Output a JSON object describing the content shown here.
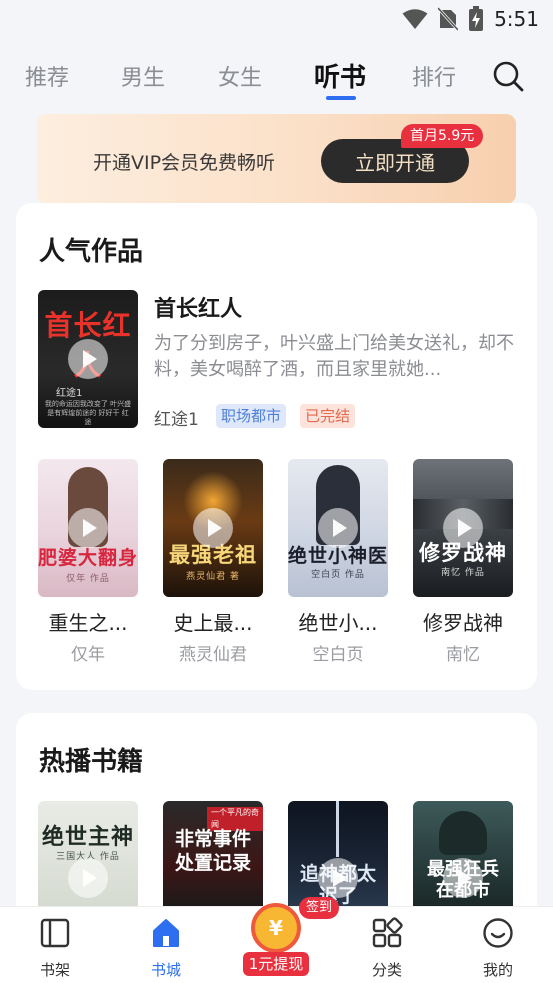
{
  "status_bar": {
    "time": "5:51",
    "icons": [
      "wifi-icon",
      "no-sim-icon",
      "battery-charging-icon"
    ]
  },
  "tabs": [
    {
      "label": "推荐",
      "active": false
    },
    {
      "label": "男生",
      "active": false
    },
    {
      "label": "女生",
      "active": false
    },
    {
      "label": "听书",
      "active": true
    },
    {
      "label": "排行",
      "active": false
    }
  ],
  "vip_banner": {
    "text": "开通VIP会员免费畅听",
    "button": "立即开通",
    "badge": "首月5.9元"
  },
  "popular": {
    "title": "人气作品",
    "featured": {
      "title": "首长红人",
      "description": "为了分到房子，叶兴盛上门给美女送礼，却不料，美女喝醉了酒，而且家里就她...",
      "author": "红途1",
      "tags": [
        "职场都市",
        "已完结"
      ],
      "cover": {
        "title": "首长红人",
        "author_line": "红途1",
        "blurb": "我的命运因我改变了 叶兴盛是有辉煌前途的 好好干 红途"
      }
    },
    "books": [
      {
        "name": "重生之...",
        "author": "仅年",
        "cover_title": "肥婆大翻身",
        "cover_sub": "仅年 作品"
      },
      {
        "name": "史上最...",
        "author": "燕灵仙君",
        "cover_title": "最强老祖",
        "cover_sub": "燕灵仙君 著"
      },
      {
        "name": "绝世小...",
        "author": "空白页",
        "cover_title": "绝世小神医",
        "cover_sub": "空白页 作品"
      },
      {
        "name": "修罗战神",
        "author": "南忆",
        "cover_title": "修罗战神",
        "cover_sub": "南忆 作品"
      }
    ]
  },
  "hot": {
    "title": "热播书籍",
    "books": [
      {
        "cover_title": "绝世主神",
        "cover_sub": "三国大人 作品"
      },
      {
        "cover_title": "非常事件处置记录",
        "cover_sub": "一个平凡的奇闻"
      },
      {
        "cover_title": "追神都太迟了"
      },
      {
        "cover_title": "最强狂兵在都市"
      }
    ]
  },
  "bottom_nav": {
    "items": [
      {
        "label": "书架",
        "active": false
      },
      {
        "label": "书城",
        "active": true
      },
      {
        "label": "分类",
        "active": false
      },
      {
        "label": "我的",
        "active": false
      }
    ],
    "withdraw_label": "1元提现",
    "coin_symbol": "¥",
    "checkin": "签到"
  },
  "colors": {
    "accent": "#2e6ff2",
    "badge_red": "#e8303f",
    "vip_dark": "#2b2b2b"
  }
}
